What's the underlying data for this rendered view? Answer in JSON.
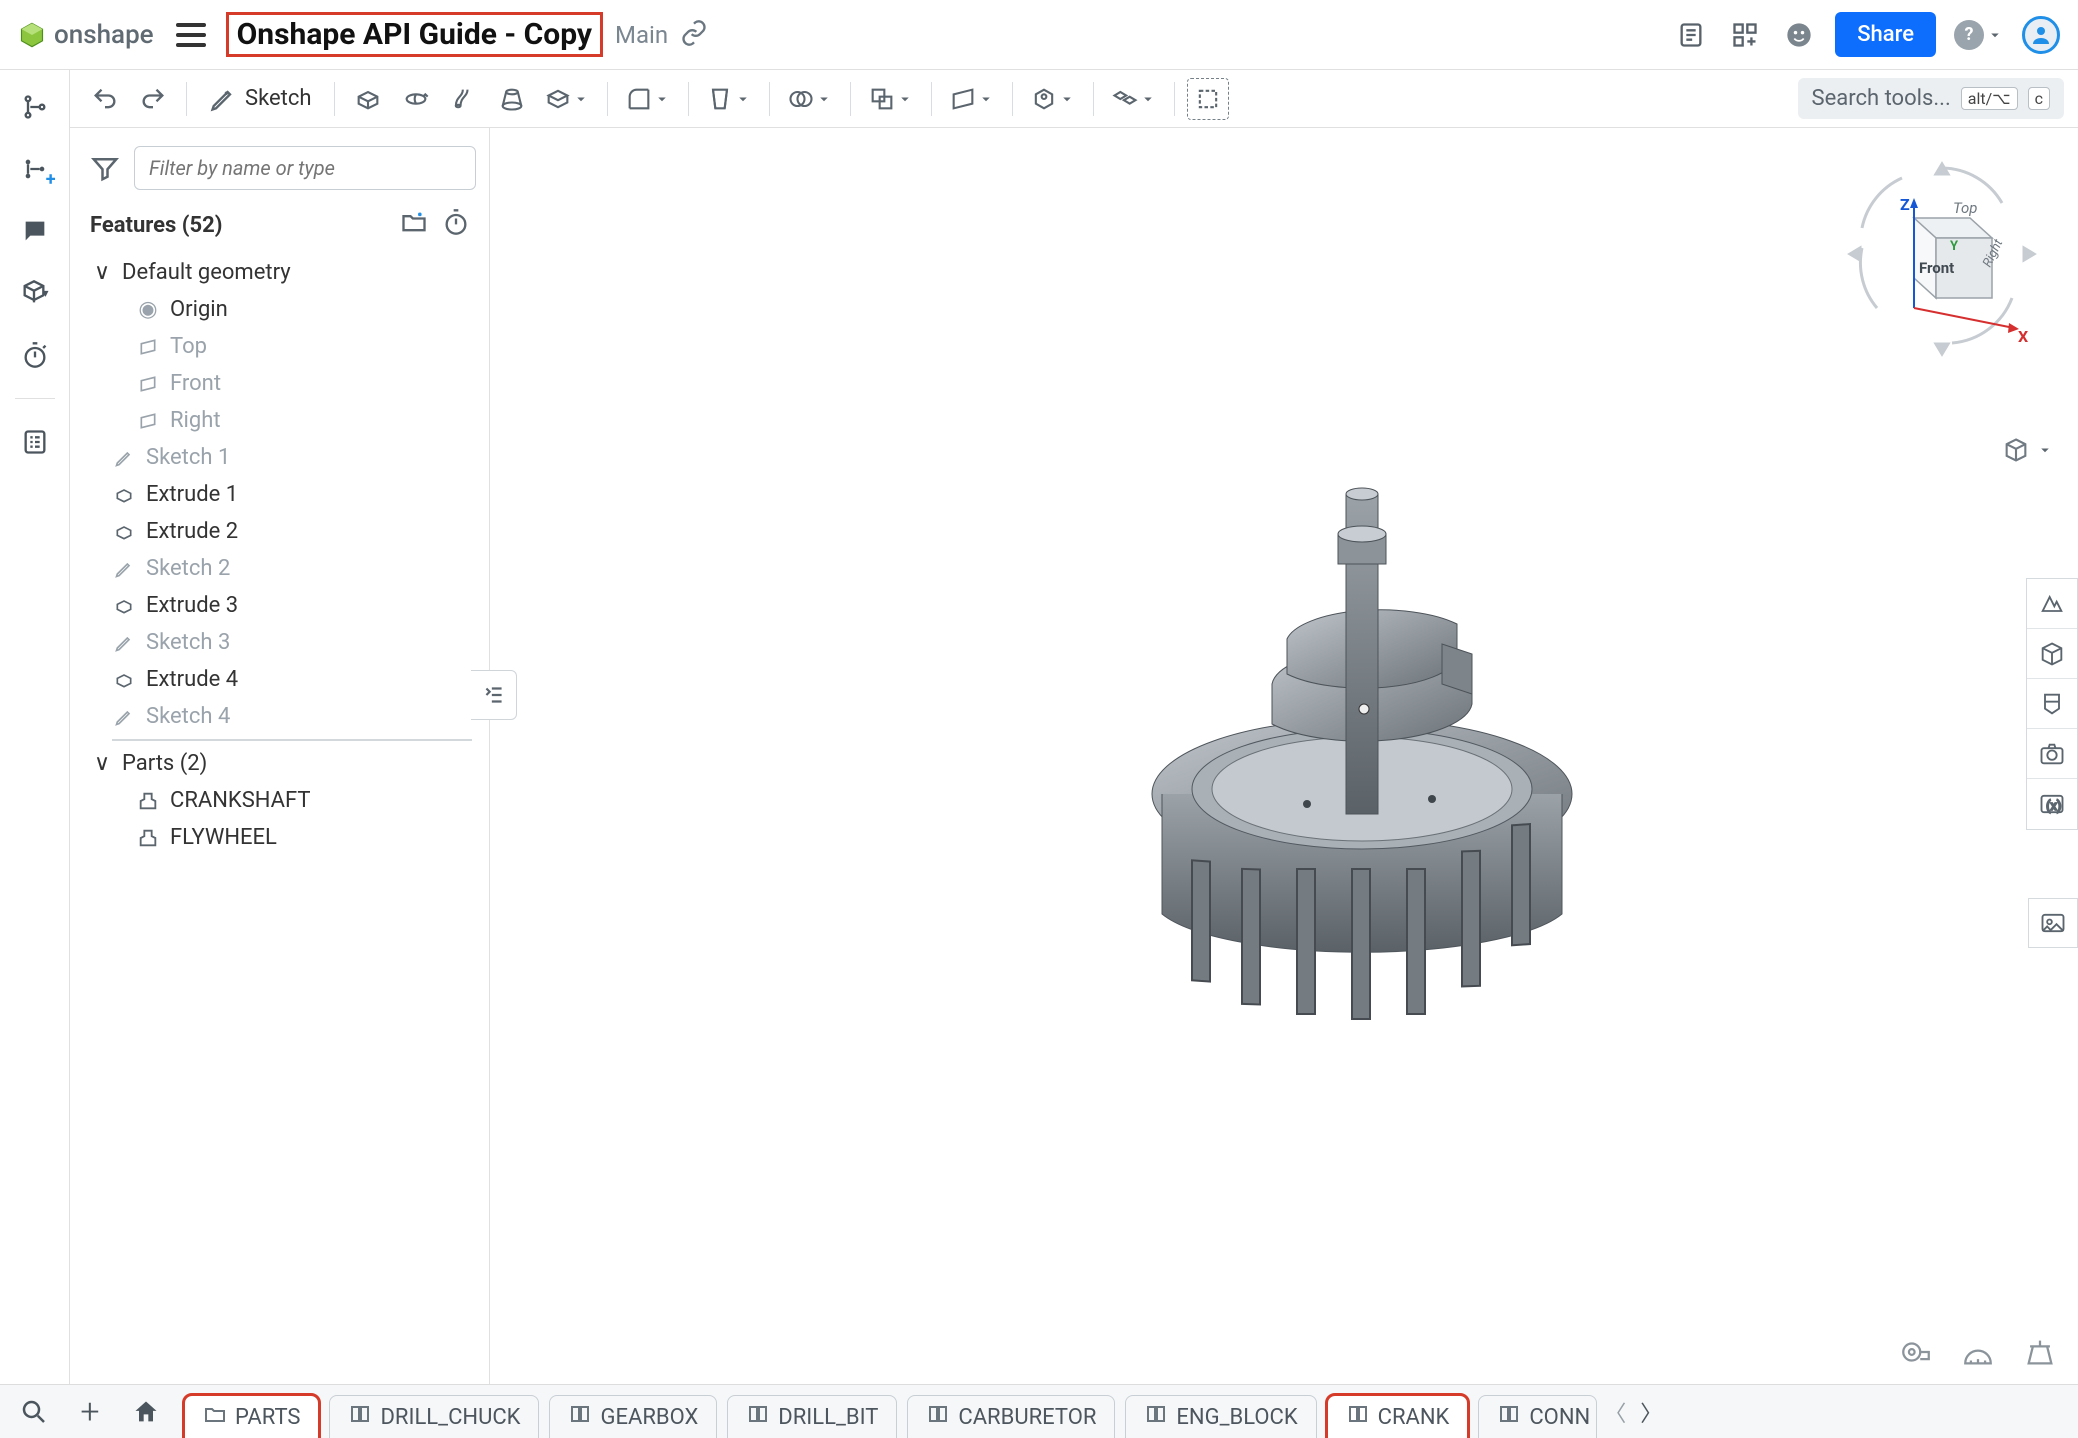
{
  "brand": "onshape",
  "document_title": "Onshape API Guide - Copy",
  "branch_label": "Main",
  "share_button": "Share",
  "toolbar": {
    "sketch_label": "Sketch",
    "search_placeholder": "Search tools...",
    "search_kbd1": "alt/⌥",
    "search_kbd2": "c"
  },
  "filter_placeholder": "Filter by name or type",
  "features_header": "Features (52)",
  "tree": {
    "default_geometry": "Default geometry",
    "origin": "Origin",
    "top": "Top",
    "front": "Front",
    "right": "Right",
    "sketch1": "Sketch 1",
    "extrude1": "Extrude 1",
    "extrude2": "Extrude 2",
    "sketch2": "Sketch 2",
    "extrude3": "Extrude 3",
    "sketch3": "Sketch 3",
    "extrude4": "Extrude 4",
    "sketch4": "Sketch 4"
  },
  "parts_header": "Parts (2)",
  "parts": {
    "crankshaft": "CRANKSHAFT",
    "flywheel": "FLYWHEEL"
  },
  "viewcube": {
    "top": "Top",
    "front": "Front",
    "right": "Right",
    "z": "Z",
    "y": "Y",
    "x": "X"
  },
  "tabs": {
    "parts": "PARTS",
    "drill_chuck": "DRILL_CHUCK",
    "gearbox": "GEARBOX",
    "drill_bit": "DRILL_BIT",
    "carburetor": "CARBURETOR",
    "eng_block": "ENG_BLOCK",
    "crank": "CRANK",
    "conn": "CONN"
  }
}
